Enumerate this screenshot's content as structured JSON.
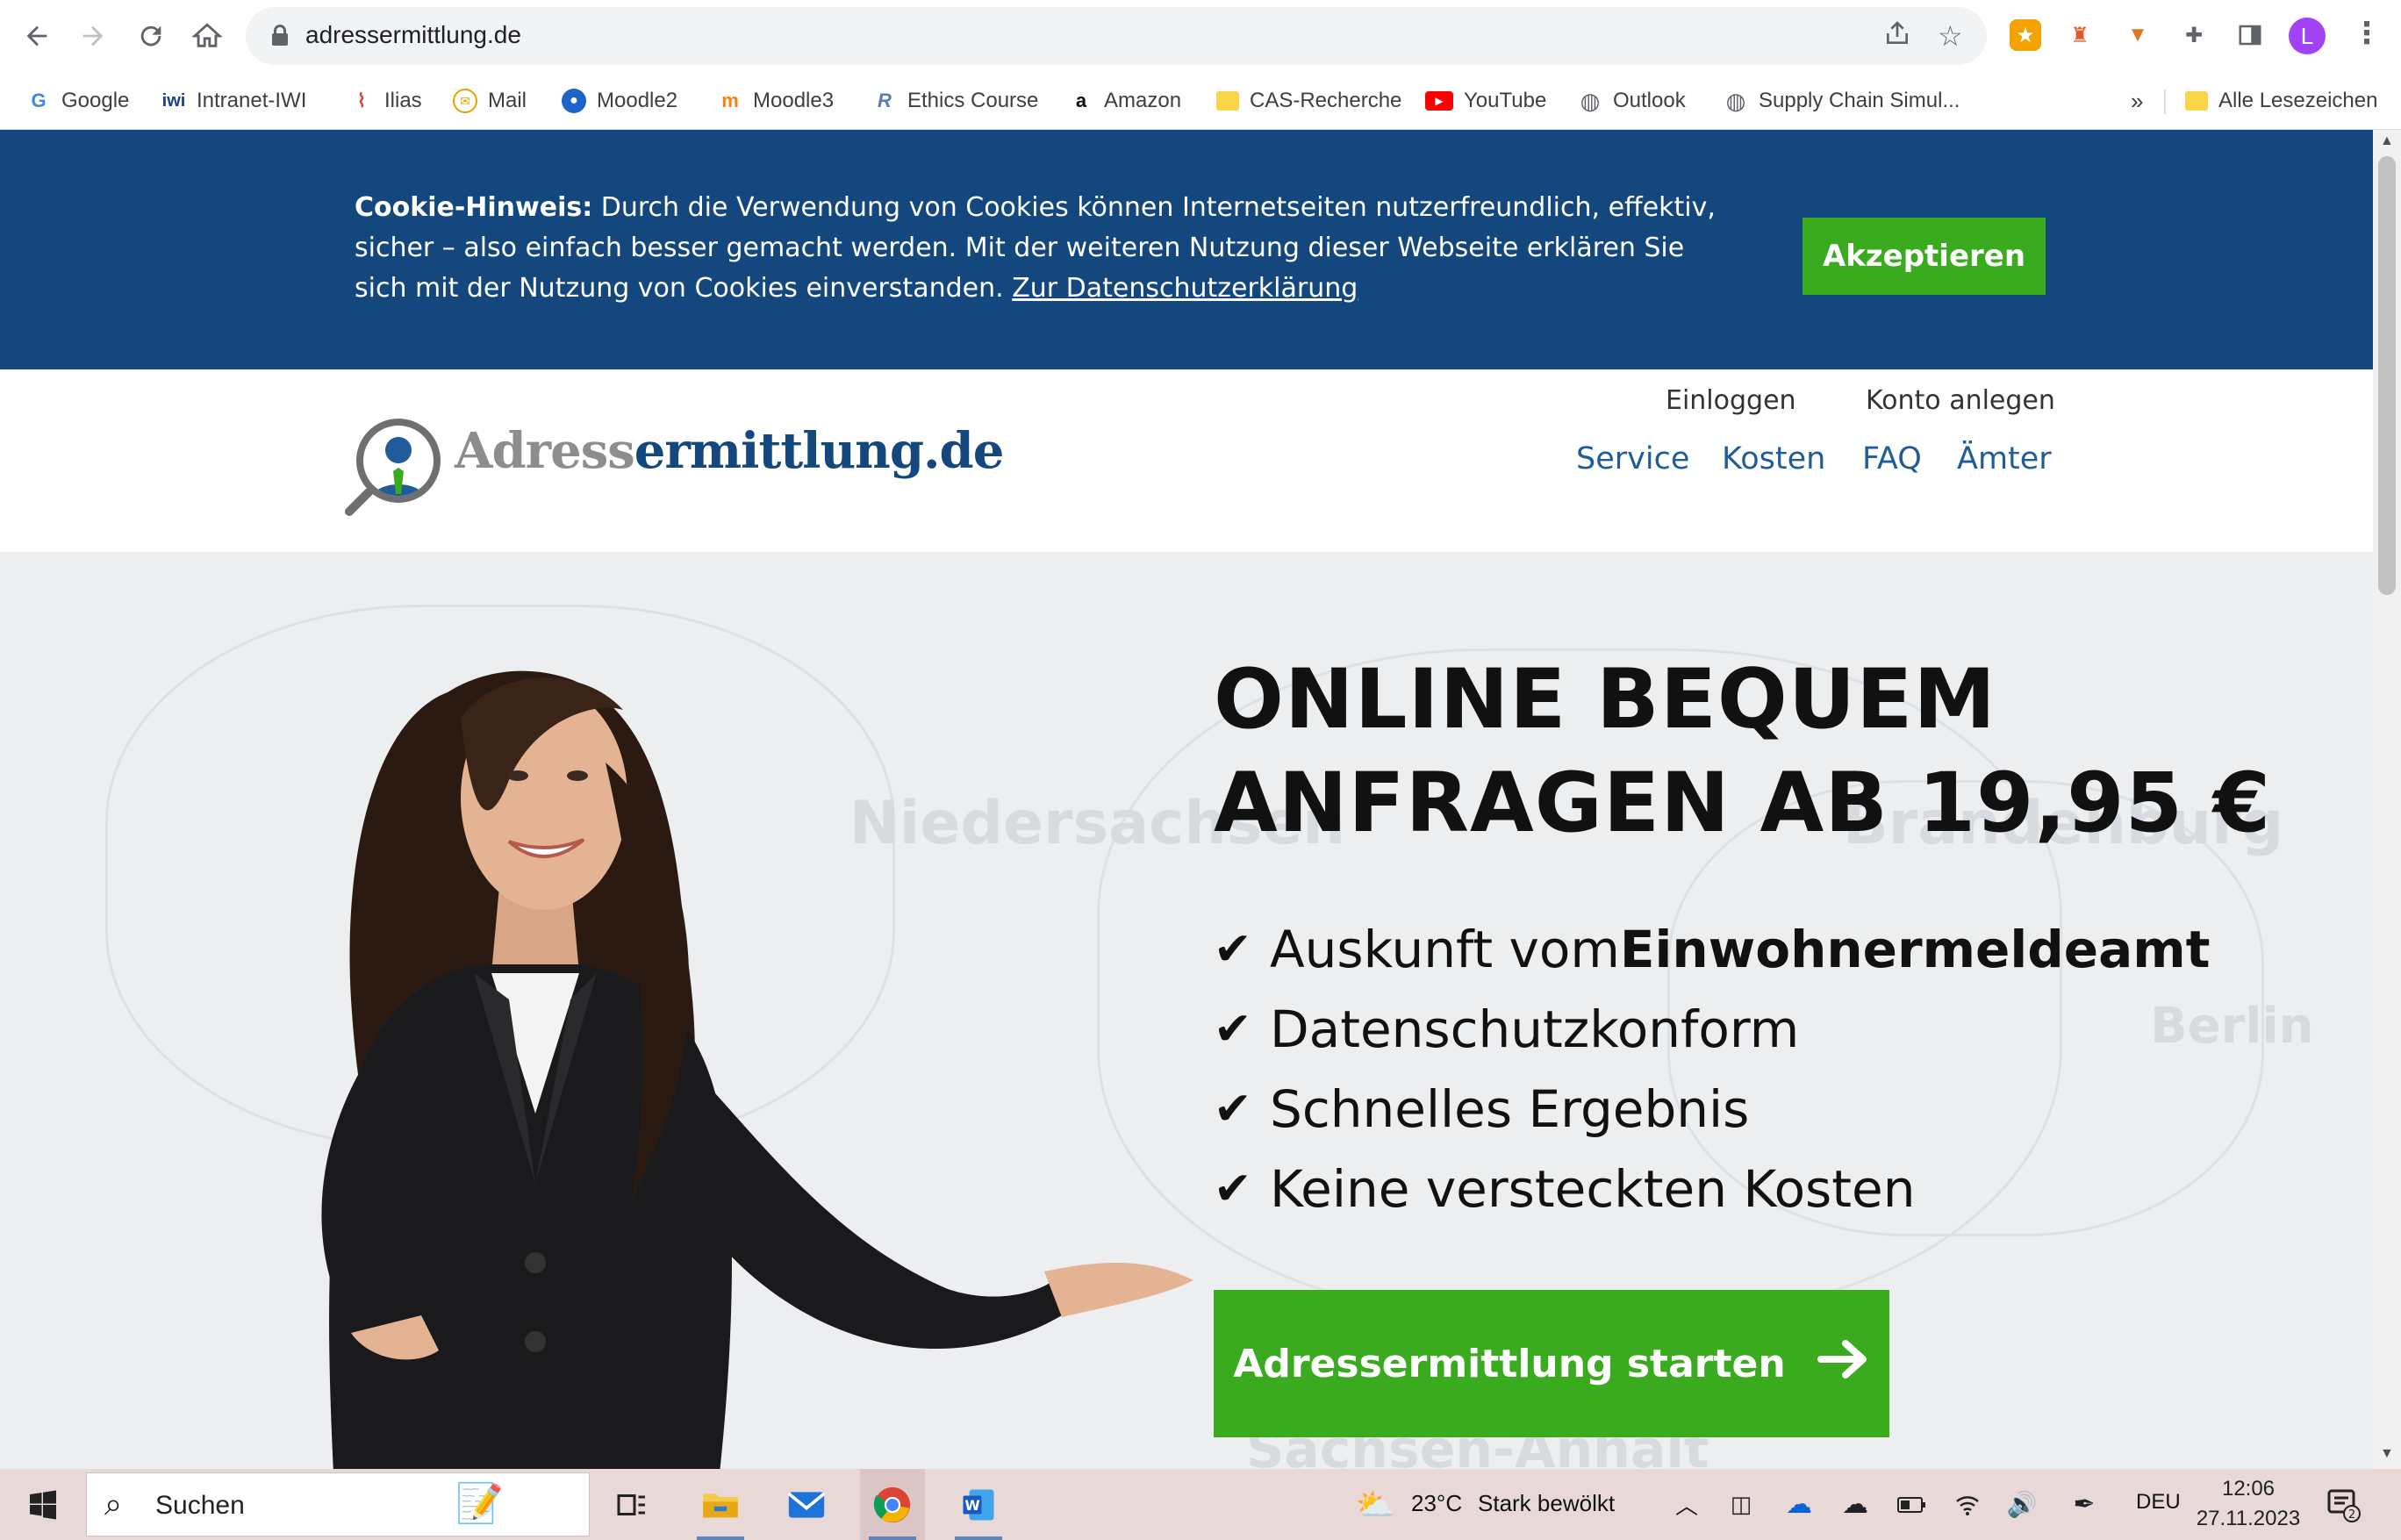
{
  "browser": {
    "url": "adressermittlung.de",
    "bookmarks": [
      {
        "label": "Google",
        "icon": "G"
      },
      {
        "label": "Intranet-IWI",
        "icon": "iwi"
      },
      {
        "label": "Ilias",
        "icon": "ilias-icon"
      },
      {
        "label": "Mail",
        "icon": "mail-icon"
      },
      {
        "label": "Moodle2",
        "icon": "moodle2-icon"
      },
      {
        "label": "Moodle3",
        "icon": "m"
      },
      {
        "label": "Ethics Course",
        "icon": "ethics-icon"
      },
      {
        "label": "Amazon",
        "icon": "a"
      },
      {
        "label": "CAS-Recherche",
        "icon": "folder"
      },
      {
        "label": "YouTube",
        "icon": "youtube-icon"
      },
      {
        "label": "Outlook",
        "icon": "globe-icon"
      },
      {
        "label": "Supply Chain Simul...",
        "icon": "globe-icon"
      }
    ],
    "overflow": "»",
    "all_bookmarks": "Alle Lesezeichen",
    "profile_initial": "L"
  },
  "cookie": {
    "title": "Cookie-Hinweis:",
    "text": " Durch die Verwendung von Cookies können Internetseiten nutzerfreundlich, effektiv, sicher – also einfach besser gemacht werden. Mit der weiteren Nutzung dieser Webseite erklären Sie sich mit der Nutzung von Cookies einverstanden. ",
    "link": "Zur Datenschutzerklärung",
    "accept": "Akzeptieren"
  },
  "header": {
    "logo_part1": "Adress",
    "logo_part2": "ermittlung.de",
    "login": "Einloggen",
    "register": "Konto anlegen",
    "nav": [
      "Service",
      "Kosten",
      "FAQ",
      "Ämter"
    ]
  },
  "hero": {
    "headline_line1": "ONLINE BEQUEM",
    "headline_line2": "ANFRAGEN AB 19,95 €",
    "features": [
      {
        "text": "Auskunft vom ",
        "bold": "Einwohnermeldeamt"
      },
      {
        "text": "Datenschutzkonform",
        "bold": ""
      },
      {
        "text": "Schnelles Ergebnis",
        "bold": ""
      },
      {
        "text": "Keine versteckten Kosten",
        "bold": ""
      }
    ],
    "check": "✔",
    "cta": "Adressermittlung starten",
    "map_labels": [
      "Niedersachsen",
      "Brandenburg",
      "Berlin",
      "Sachsen-Anhalt"
    ]
  },
  "taskbar": {
    "search": "Suchen",
    "temperature": "23°C",
    "weather": "Stark bewölkt",
    "language": "DEU",
    "time": "12:06",
    "date": "27.11.2023",
    "notifications": "2"
  },
  "colors": {
    "cookie_bg": "#13477d",
    "accent_green": "#3aaa1f",
    "nav_blue": "#1f5c99",
    "logo_grey": "#8d8d8d"
  }
}
